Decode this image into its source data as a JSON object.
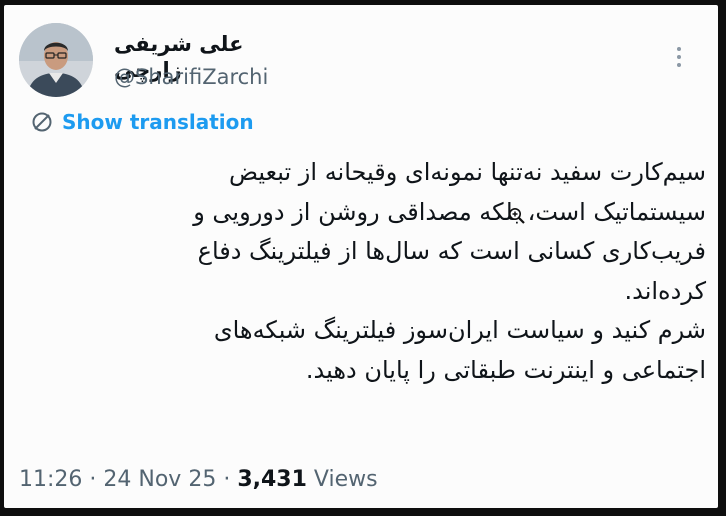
{
  "author": {
    "display_name": "علی شریفی زارچی",
    "handle": "@SharifiZarchi"
  },
  "translation": {
    "label": "Show translation"
  },
  "tweet": {
    "lines": [
      "سیم‌کارت سفید نه‌تنها نمونه‌ای وقیحانه از تبعیض",
      "سیستماتیک است، بلکه مصداقی روشن از دورویی و",
      "فریب‌کاری کسانی است که سال‌ها از فیلترینگ دفاع",
      "کرده‌اند.",
      "شرم کنید و سیاست ایران‌سوز فیلترینگ شبکه‌های",
      "اجتماعی و اینترنت طبقاتی را پایان دهید."
    ]
  },
  "meta": {
    "time": "11:26",
    "separator": "·",
    "date": "24 Nov 25",
    "views_count": "3,431",
    "views_label": "Views"
  },
  "colors": {
    "accent": "#1d9bf0",
    "secondary_text": "#536471",
    "primary_text": "#0f1419"
  },
  "icons": {
    "translate": "translate-icon",
    "more": "more-options-icon",
    "cursor": "zoom-in-cursor-icon"
  }
}
